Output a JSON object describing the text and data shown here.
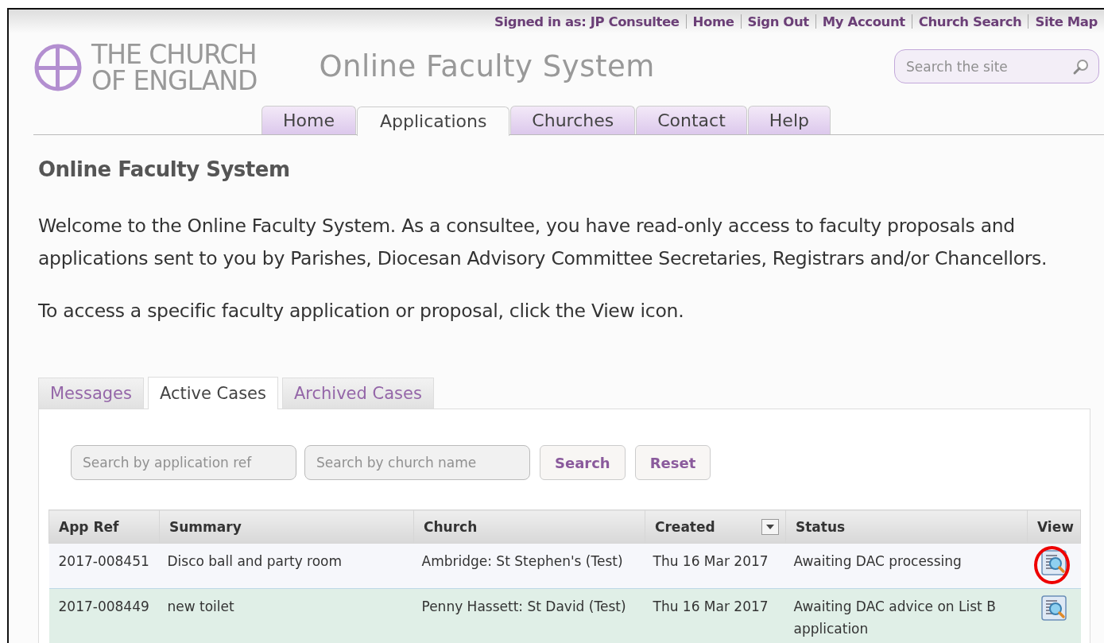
{
  "top_links": {
    "signed_in": "Signed in as: JP Consultee",
    "links": [
      "Home",
      "Sign Out",
      "My Account",
      "Church Search",
      "Site Map"
    ]
  },
  "logo": {
    "line1": "THE CHURCH",
    "line2": "OF ENGLAND"
  },
  "site_title": "Online Faculty System",
  "site_search": {
    "placeholder": "Search the site"
  },
  "nav_tabs": [
    {
      "label": "Home",
      "selected": false
    },
    {
      "label": "Applications",
      "selected": true
    },
    {
      "label": "Churches",
      "selected": false
    },
    {
      "label": "Contact",
      "selected": false
    },
    {
      "label": "Help",
      "selected": false
    }
  ],
  "page_heading": "Online Faculty System",
  "intro": [
    "Welcome to the Online Faculty System. As a consultee, you have read-only access to faculty proposals and applications sent to you by Parishes, Diocesan Advisory Committee Secretaries, Registrars and/or Chancellors.",
    "To access a specific faculty application or proposal, click the View icon."
  ],
  "case_tabs": [
    {
      "label": "Messages",
      "selected": false
    },
    {
      "label": "Active Cases",
      "selected": true
    },
    {
      "label": "Archived Cases",
      "selected": false
    }
  ],
  "filters": {
    "fields": [
      {
        "placeholder": "Search by application ref"
      },
      {
        "placeholder": "Search by church name"
      }
    ],
    "buttons": [
      "Search",
      "Reset"
    ]
  },
  "table": {
    "columns": [
      {
        "label": "App Ref",
        "sortable": false
      },
      {
        "label": "Summary",
        "sortable": false
      },
      {
        "label": "Church",
        "sortable": false
      },
      {
        "label": "Created",
        "sortable": true
      },
      {
        "label": "Status",
        "sortable": false
      },
      {
        "label": "View",
        "sortable": false
      }
    ],
    "rows": [
      {
        "cells": [
          "2017-008451",
          "Disco ball and party room",
          "Ambridge: St Stephen's (Test)",
          "Thu 16 Mar 2017",
          "Awaiting DAC processing"
        ],
        "highlighted": false,
        "circled": true
      },
      {
        "cells": [
          "2017-008449",
          "new toilet",
          "Penny Hassett: St David (Test)",
          "Thu 16 Mar 2017",
          "Awaiting DAC advice on List B application"
        ],
        "highlighted": true,
        "circled": false
      }
    ]
  }
}
